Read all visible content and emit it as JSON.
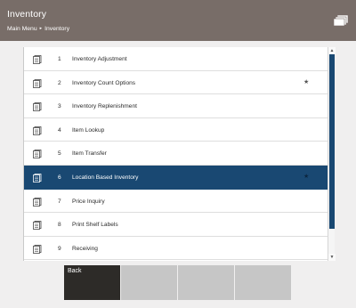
{
  "header": {
    "title": "Inventory",
    "breadcrumb": [
      "Main Menu",
      "Inventory"
    ]
  },
  "menu": {
    "items": [
      {
        "number": "1",
        "label": "Inventory Adjustment",
        "icon": "grid-icon",
        "selected": false,
        "starred": false
      },
      {
        "number": "2",
        "label": "Inventory Count Options",
        "icon": "grid-icon",
        "selected": false,
        "starred": true
      },
      {
        "number": "3",
        "label": "Inventory Replenishment",
        "icon": "grid-icon",
        "selected": false,
        "starred": false
      },
      {
        "number": "4",
        "label": "Item Lookup",
        "icon": "grid-icon",
        "selected": false,
        "starred": false
      },
      {
        "number": "5",
        "label": "Item Transfer",
        "icon": "grid-icon",
        "selected": false,
        "starred": false
      },
      {
        "number": "6",
        "label": "Location Based Inventory",
        "icon": "grid-icon",
        "selected": true,
        "starred": true
      },
      {
        "number": "7",
        "label": "Price Inquiry",
        "icon": "grid-icon",
        "selected": false,
        "starred": false
      },
      {
        "number": "8",
        "label": "Print Shelf Labels",
        "icon": "grid-icon",
        "selected": false,
        "starred": false
      },
      {
        "number": "9",
        "label": "Receiving",
        "icon": "grid-icon",
        "selected": false,
        "starred": false
      }
    ]
  },
  "buttons": {
    "back_label": "Back",
    "blank_count": 3
  },
  "colors": {
    "header_bg": "#786d68",
    "selected_row": "#194872",
    "back_button": "#2d2b28",
    "disabled_button": "#c6c6c6"
  }
}
